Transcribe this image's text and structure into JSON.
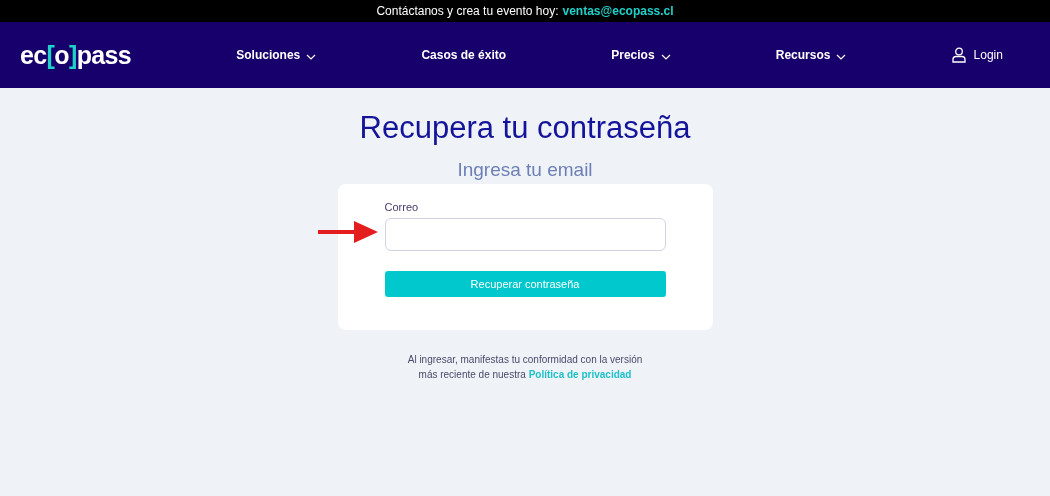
{
  "top_bar": {
    "text": "Contáctanos y crea tu evento hoy:",
    "email": "ventas@ecopass.cl"
  },
  "logo": {
    "prefix": "ec",
    "bracket_left": "[",
    "middle": "o",
    "bracket_right": "]",
    "suffix": "pass"
  },
  "nav": [
    {
      "label": "Soluciones",
      "has_dropdown": true
    },
    {
      "label": "Casos de éxito",
      "has_dropdown": false
    },
    {
      "label": "Precios",
      "has_dropdown": true
    },
    {
      "label": "Recursos",
      "has_dropdown": true
    }
  ],
  "login": {
    "label": "Login"
  },
  "title": "Recupera tu contraseña",
  "subtitle": "Ingresa tu email",
  "form": {
    "field_label": "Correo",
    "button": "Recuperar contraseña"
  },
  "footer": {
    "text": "Al ingresar, manifestas tu conformidad con la versión más reciente de nuestra",
    "link": "Política de privacidad"
  }
}
